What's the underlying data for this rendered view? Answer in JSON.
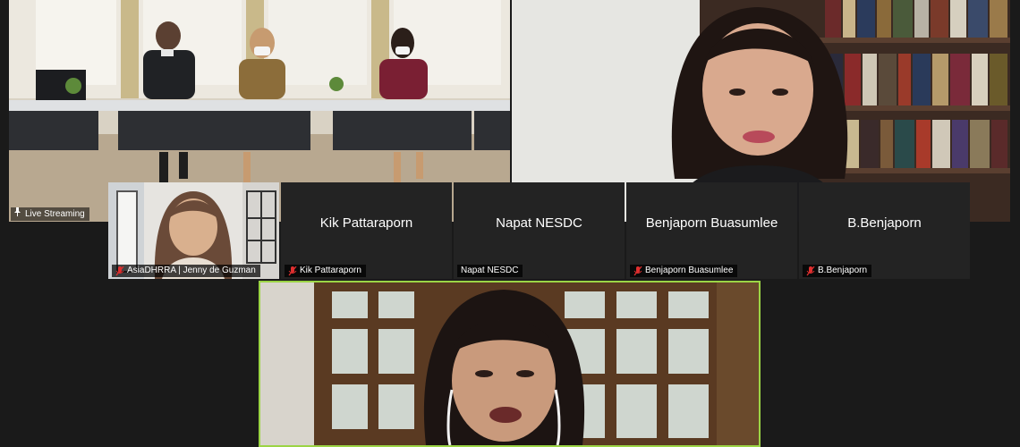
{
  "tiles": {
    "room": {
      "label": "Live Streaming",
      "icon": "pin-icon"
    },
    "library": {},
    "jenny": {
      "name": "AsiaDHRRA | Jenny de Guzman",
      "muted": true
    },
    "kik": {
      "display_name": "Kik Pattaraporn",
      "name": "Kik Pattaraporn",
      "muted": true
    },
    "napat": {
      "display_name": "Napat NESDC",
      "name": "Napat NESDC",
      "muted": false
    },
    "benj": {
      "display_name": "Benjaporn Buasumlee",
      "name": "Benjaporn Buasumlee",
      "muted": true
    },
    "bb": {
      "display_name": "B.Benjaporn",
      "name": "B.Benjaporn",
      "muted": true
    },
    "speaker": {
      "active": true
    }
  },
  "colors": {
    "active_speaker_border": "#9bd445",
    "muted_icon": "#e02f2f",
    "tile_bg": "#232323",
    "app_bg": "#1a1a1a"
  }
}
